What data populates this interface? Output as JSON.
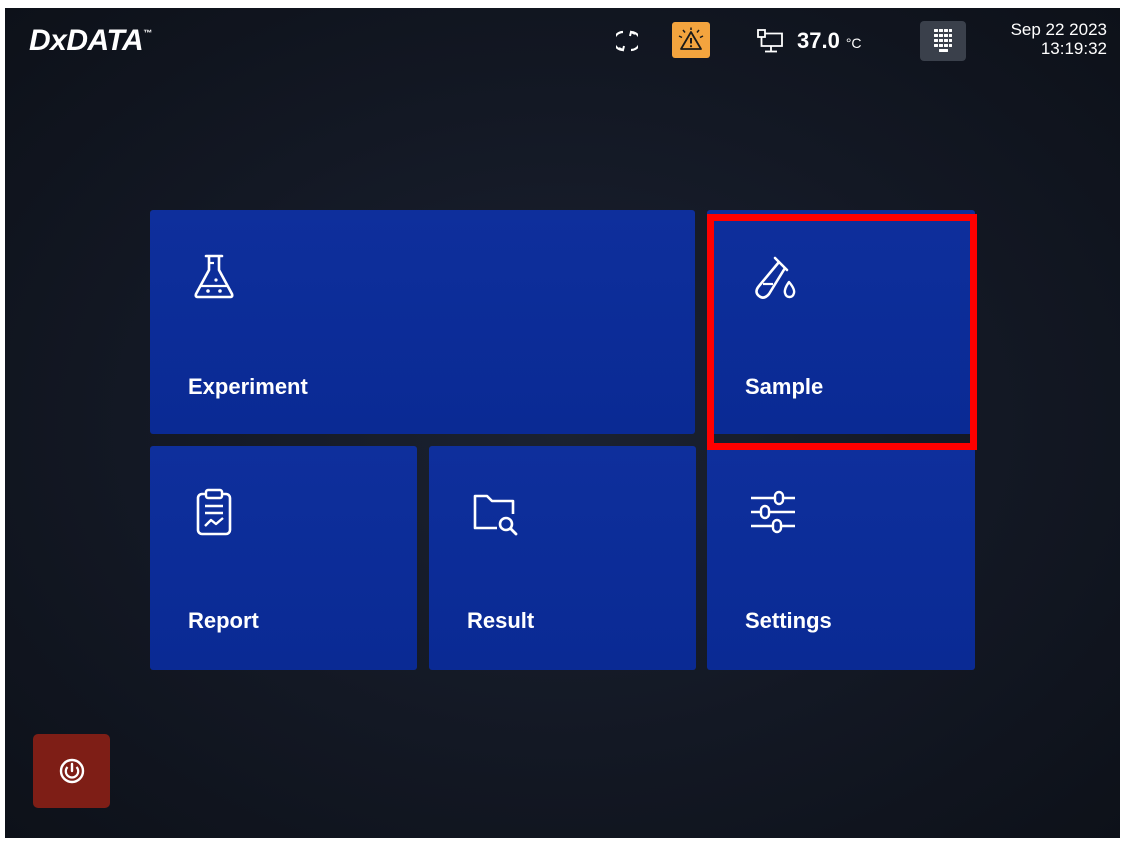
{
  "header": {
    "logo_text": "DxDATA",
    "logo_tm": "™",
    "temperature": "37.0",
    "temperature_unit": "°C",
    "date": "Sep 22 2023",
    "time": "13:19:32"
  },
  "icons": {
    "sync": "sync-icon",
    "alert": "warning-alert-icon",
    "network": "network-icon",
    "keypad": "keypad-icon",
    "power": "power-icon"
  },
  "tiles": [
    {
      "label": "Experiment",
      "icon": "flask-icon"
    },
    {
      "label": "Sample",
      "icon": "test-tube-icon"
    },
    {
      "label": "Report",
      "icon": "clipboard-report-icon"
    },
    {
      "label": "Result",
      "icon": "folder-search-icon"
    },
    {
      "label": "Settings",
      "icon": "sliders-icon"
    }
  ],
  "colors": {
    "tile_blue": "#0c2d99",
    "alert_orange": "#f3a43e",
    "power_red": "#7e1e16",
    "highlight_red": "#ff0000",
    "background": "#131824"
  }
}
